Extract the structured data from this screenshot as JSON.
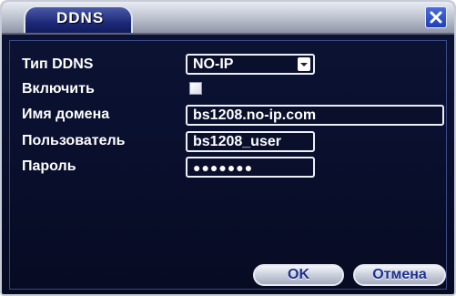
{
  "window": {
    "title": "DDNS",
    "close_icon": "close-x-icon"
  },
  "form": {
    "ddns_type_label": "Тип DDNS",
    "ddns_type_value": "NO-IP",
    "enable_label": "Включить",
    "enable_checked": false,
    "domain_label": "Имя домена",
    "domain_value": "bs1208.no-ip.com",
    "user_label": "Пользователь",
    "user_value": "bs1208_user",
    "password_label": "Пароль",
    "password_value": "●●●●●●●"
  },
  "buttons": {
    "ok_label": "OK",
    "cancel_label": "Отмена"
  },
  "colors": {
    "background": "#0a1030",
    "accent": "#1c2f8e",
    "text": "#ffffff"
  }
}
